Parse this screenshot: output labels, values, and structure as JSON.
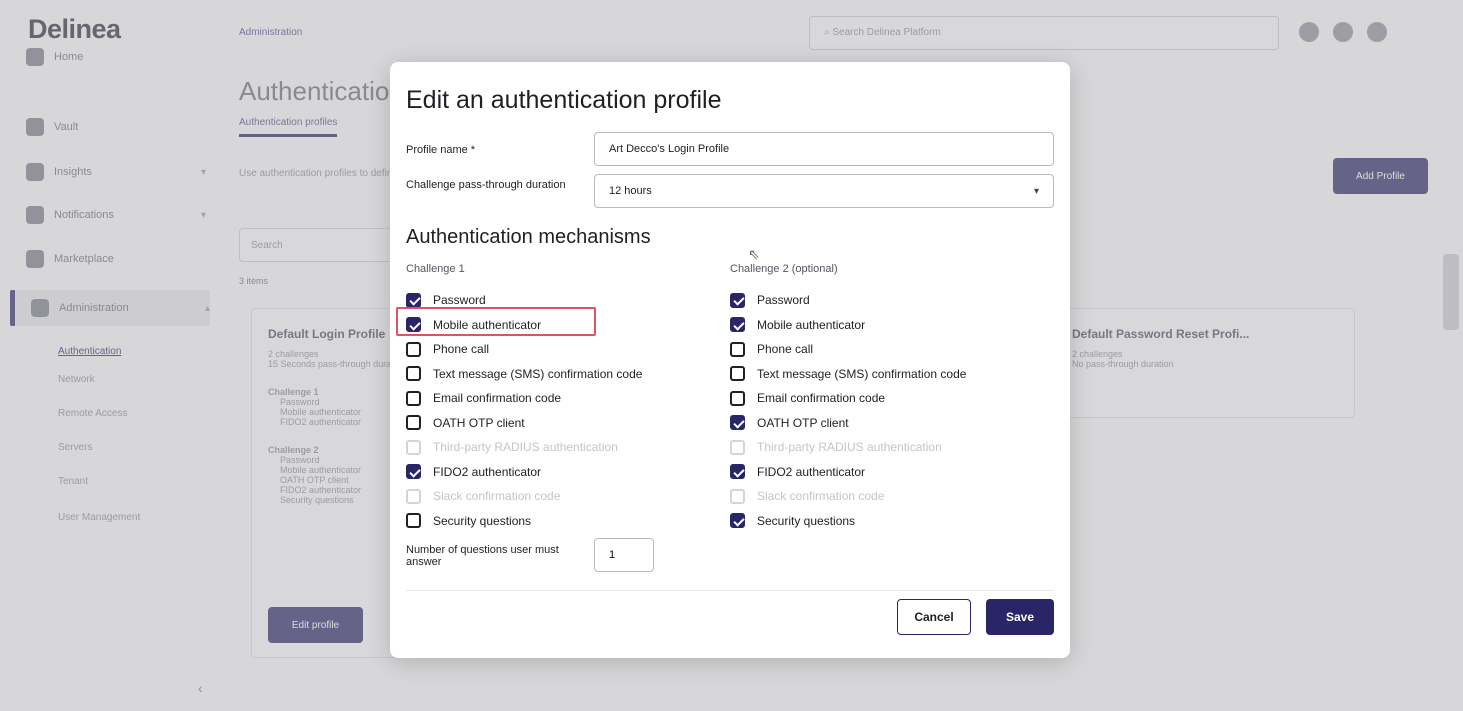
{
  "app": {
    "logo": "Delinea",
    "sidebar": {
      "items": [
        {
          "label": "Home"
        },
        {
          "label": "Vault"
        },
        {
          "label": "Insights"
        },
        {
          "label": "Notifications"
        },
        {
          "label": "Marketplace"
        },
        {
          "label": "Administration"
        }
      ],
      "subitems": [
        "Authentication",
        "Network",
        "Remote Access",
        "Servers",
        "Tenant",
        "User Management"
      ]
    },
    "breadcrumb": "Administration",
    "search_placeholder": "Search Delinea Platform",
    "page_title": "Authentication",
    "tab_label": "Authentication profiles",
    "description": "Use authentication profiles to define requirements",
    "add_profile_label": "Add Profile",
    "list_search_placeholder": "Search",
    "item_count": "3 items",
    "cards": [
      {
        "title": "Default Login Profile",
        "lines": [
          "2 challenges",
          "15 Seconds pass-through duration",
          "Challenge 1",
          "Password",
          "Mobile authenticator",
          "FIDO2 authenticator",
          "Challenge 2",
          "Password",
          "Mobile authenticator",
          "OATH OTP client",
          "FIDO2 authenticator",
          "Security questions"
        ]
      },
      {
        "title": "Default Password Reset Profi...",
        "lines": [
          "2 challenges",
          "No pass-through duration"
        ]
      }
    ],
    "edit_profile_label": "Edit profile"
  },
  "modal": {
    "title": "Edit an authentication profile",
    "profile_name_label": "Profile name *",
    "profile_name_value": "Art Decco's Login Profile",
    "duration_label": "Challenge pass-through duration",
    "duration_value": "12 hours",
    "section_title": "Authentication mechanisms",
    "challenge1_label": "Challenge 1",
    "challenge2_label": "Challenge 2 (optional)",
    "challenge1": [
      {
        "label": "Password",
        "checked": true,
        "disabled": false
      },
      {
        "label": "Mobile authenticator",
        "checked": true,
        "disabled": false
      },
      {
        "label": "Phone call",
        "checked": false,
        "disabled": false
      },
      {
        "label": "Text message (SMS) confirmation code",
        "checked": false,
        "disabled": false
      },
      {
        "label": "Email confirmation code",
        "checked": false,
        "disabled": false
      },
      {
        "label": "OATH OTP client",
        "checked": false,
        "disabled": false
      },
      {
        "label": "Third-party RADIUS authentication",
        "checked": false,
        "disabled": true
      },
      {
        "label": "FIDO2 authenticator",
        "checked": true,
        "disabled": false
      },
      {
        "label": "Slack confirmation code",
        "checked": false,
        "disabled": true
      },
      {
        "label": "Security questions",
        "checked": false,
        "disabled": false
      }
    ],
    "challenge2": [
      {
        "label": "Password",
        "checked": true,
        "disabled": false
      },
      {
        "label": "Mobile authenticator",
        "checked": true,
        "disabled": false
      },
      {
        "label": "Phone call",
        "checked": false,
        "disabled": false
      },
      {
        "label": "Text message (SMS) confirmation code",
        "checked": false,
        "disabled": false
      },
      {
        "label": "Email confirmation code",
        "checked": false,
        "disabled": false
      },
      {
        "label": "OATH OTP client",
        "checked": true,
        "disabled": false
      },
      {
        "label": "Third-party RADIUS authentication",
        "checked": false,
        "disabled": true
      },
      {
        "label": "FIDO2 authenticator",
        "checked": true,
        "disabled": false
      },
      {
        "label": "Slack confirmation code",
        "checked": false,
        "disabled": true
      },
      {
        "label": "Security questions",
        "checked": true,
        "disabled": false
      }
    ],
    "questions_label": "Number of questions user must answer",
    "questions_value": "1",
    "cancel_label": "Cancel",
    "save_label": "Save"
  },
  "colors": {
    "brand": "#2a2566",
    "highlight": "#e05260"
  }
}
